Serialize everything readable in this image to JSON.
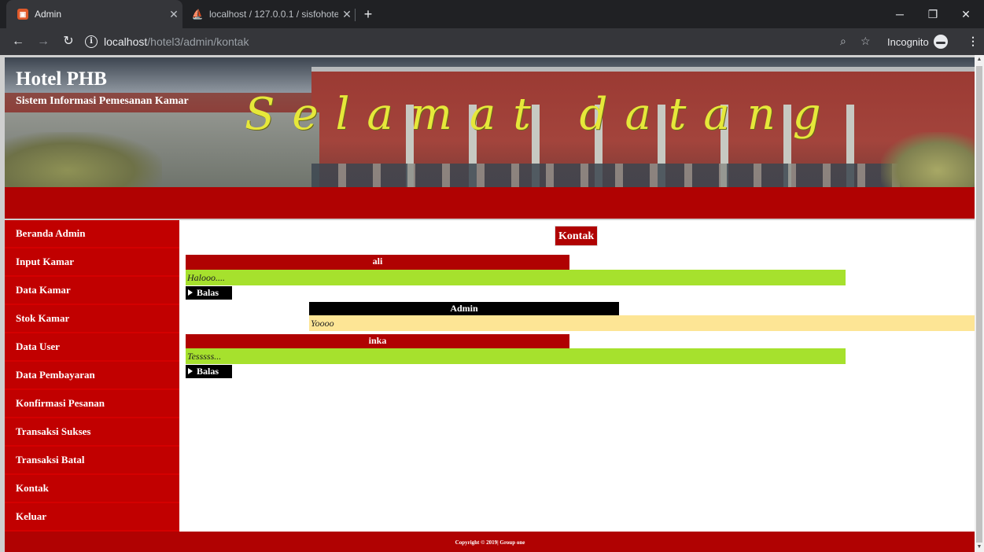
{
  "browser": {
    "tabs": [
      {
        "title": "Admin",
        "active": true
      },
      {
        "title": "localhost / 127.0.0.1 / sisfohotel /",
        "active": false
      }
    ],
    "url_host": "localhost",
    "url_path": "/hotel3/admin/kontak",
    "incognito_label": "Incognito"
  },
  "header": {
    "title": "Hotel PHB",
    "subtitle": "Sistem Informasi Pemesanan Kamar",
    "welcome": "Selamat datang"
  },
  "sidebar": {
    "items": [
      {
        "label": "Beranda Admin"
      },
      {
        "label": "Input Kamar"
      },
      {
        "label": "Data Kamar"
      },
      {
        "label": "Stok Kamar"
      },
      {
        "label": "Data User"
      },
      {
        "label": "Data Pembayaran"
      },
      {
        "label": "Konfirmasi Pesanan"
      },
      {
        "label": "Transaksi Sukses"
      },
      {
        "label": "Transaksi Batal"
      },
      {
        "label": "Kontak"
      },
      {
        "label": "Keluar"
      }
    ]
  },
  "main": {
    "heading": "Kontak",
    "messages": [
      {
        "sender": "ali",
        "text": "Halooo....",
        "reply_label": "Balas"
      },
      {
        "sender": "Admin",
        "text": "Yoooo"
      },
      {
        "sender": "inka",
        "text": "Tesssss...",
        "reply_label": "Balas"
      }
    ]
  },
  "footer": {
    "text": "Copyright © 2019| Group one"
  },
  "colors": {
    "brand_red": "#b00202",
    "user_message": "#a6e12d",
    "admin_message": "#fde595"
  }
}
